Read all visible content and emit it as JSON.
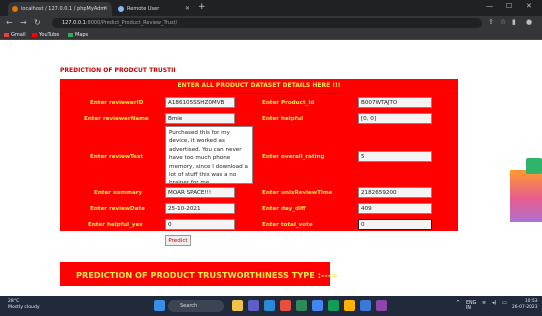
{
  "browser": {
    "tabs": [
      {
        "title": "localhost / 127.0.0.1 / phpMyAdm"
      },
      {
        "title": "Remote User"
      }
    ],
    "url_host": "127.0.0.1",
    "url_path": ":8000/Predict_Product_Review_Trust/",
    "bookmarks": [
      "Gmail",
      "YouTube",
      "Maps"
    ]
  },
  "page": {
    "title": "PREDICTION OF PRODCUT TRUSTII",
    "panel_header": "ENTER ALL PRODUCT DATASET DETAILS HERE !!!",
    "fields": {
      "reviewerID": {
        "label": "Enter reviewerID",
        "value": "A186105SSHZ0MVB"
      },
      "reviewerName": {
        "label": "Enter reviewerName",
        "value": "Bmie"
      },
      "reviewText": {
        "label": "Enter reviewText",
        "value": "Purchased this for my device, it worked as advertised. You can never have too much phone memory, since I download a lot of stuff this was a no brainer for me."
      },
      "summary": {
        "label": "Enter summary",
        "value": "MOAR SPACE!!!"
      },
      "reviewDate": {
        "label": "Enter reviewDate",
        "value": "25-10-2021"
      },
      "helpful_yes": {
        "label": "Enter helpful_yes",
        "value": "0"
      },
      "product_id": {
        "label": "Enter Product_id",
        "value": "B007WTAJTO"
      },
      "helpful": {
        "label": "Enter helpful",
        "value": "[0, 0]"
      },
      "overall_rating": {
        "label": "Enter overall_rating",
        "value": "5"
      },
      "unixReviewTime": {
        "label": "Enter unixReviewTime",
        "value": "2182659200"
      },
      "day_diff": {
        "label": "Enter day_diff",
        "value": "409"
      },
      "total_vote": {
        "label": "Enter total_vote",
        "value": "0"
      }
    },
    "predict_label": "Predict",
    "result_text": "PREDICTION OF PRODUCT TRUSTWORTHINESS TYPE :--->"
  },
  "taskbar": {
    "weather_temp": "28°C",
    "weather_desc": "Mostly cloudy",
    "search_placeholder": "Search",
    "lang": "ENG",
    "lang_sub": "IN",
    "time": "10:53",
    "date": "26-07-2023"
  },
  "colors": {
    "panel": "#ff0000",
    "label": "#ffe84a",
    "title": "#cc0000"
  }
}
